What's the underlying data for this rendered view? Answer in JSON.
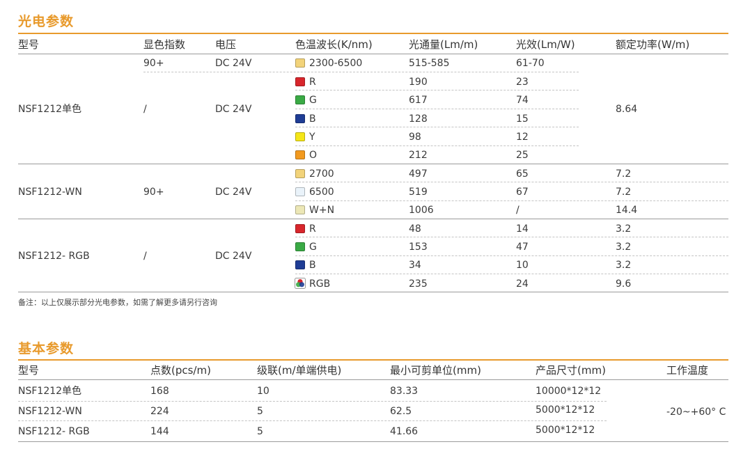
{
  "optical": {
    "title": "光电参数",
    "headers": [
      "型号",
      "显色指数",
      "电压",
      "色温波长(K/nm)",
      "光通量(Lm/m)",
      "光效(Lm/W)",
      "额定功率(W/m)"
    ],
    "group1": {
      "model": "NSF1212单色",
      "cri": "/",
      "voltage": "DC 24V",
      "power": "8.64",
      "first_row": {
        "cri": "90+",
        "voltage": "DC 24V",
        "color": "2300-6500",
        "flux": "515-585",
        "efficacy": "61-70"
      },
      "rows": [
        {
          "color": "R",
          "flux": "190",
          "efficacy": "23"
        },
        {
          "color": "G",
          "flux": "617",
          "efficacy": "74"
        },
        {
          "color": "B",
          "flux": "128",
          "efficacy": "15"
        },
        {
          "color": "Y",
          "flux": "98",
          "efficacy": "12"
        },
        {
          "color": "O",
          "flux": "212",
          "efficacy": "25"
        }
      ]
    },
    "group2": {
      "model": "NSF1212-WN",
      "cri": "90+",
      "voltage": "DC 24V",
      "rows": [
        {
          "color": "2700",
          "flux": "497",
          "efficacy": "65",
          "power": "7.2"
        },
        {
          "color": "6500",
          "flux": "519",
          "efficacy": "67",
          "power": "7.2"
        },
        {
          "color": "W+N",
          "flux": "1006",
          "efficacy": "/",
          "power": "14.4"
        }
      ]
    },
    "group3": {
      "model": "NSF1212- RGB",
      "cri": "/",
      "voltage": "DC 24V",
      "rows": [
        {
          "color": "R",
          "flux": "48",
          "efficacy": "14",
          "power": "3.2"
        },
        {
          "color": "G",
          "flux": "153",
          "efficacy": "47",
          "power": "3.2"
        },
        {
          "color": "B",
          "flux": "34",
          "efficacy": "10",
          "power": "3.2"
        },
        {
          "color": "RGB",
          "flux": "235",
          "efficacy": "24",
          "power": "9.6"
        }
      ]
    },
    "note": "备注：以上仅展示部分光电参数，如需了解更多请另行咨询"
  },
  "basic": {
    "title": "基本参数",
    "headers": [
      "型号",
      "点数(pcs/m)",
      "级联(m/单端供电)",
      "最小可剪单位(mm)",
      "产品尺寸(mm)",
      "工作温度"
    ],
    "rows": [
      {
        "model": "NSF1212单色",
        "points": "168",
        "cascade": "10",
        "cut": "83.33",
        "size": "10000*12*12"
      },
      {
        "model": "NSF1212-WN",
        "points": "224",
        "cascade": "5",
        "cut": "62.5",
        "size": "5000*12*12"
      },
      {
        "model": "NSF1212- RGB",
        "points": "144",
        "cascade": "5",
        "cut": "41.66",
        "size": "5000*12*12"
      }
    ],
    "temperature": "-20~+60° C"
  },
  "swatch_colors": {
    "warm": "#f2d37a",
    "red": "#d8262c",
    "green": "#3aaa45",
    "blue": "#1f3d95",
    "yellow": "#f5e618",
    "orange": "#f29a1f",
    "cool": "#eaf3fa",
    "mix": "#ece7b6",
    "accent": "#e89a2c"
  }
}
